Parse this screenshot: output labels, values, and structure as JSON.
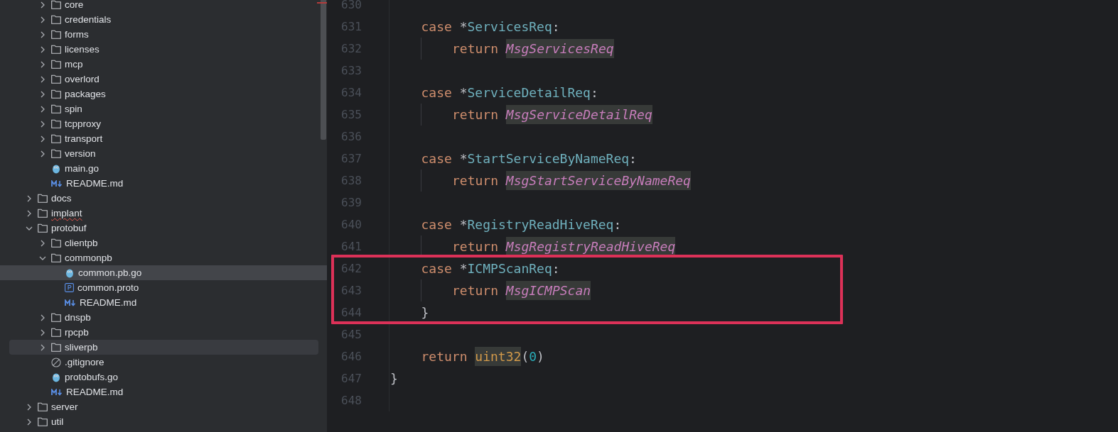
{
  "project_tree": {
    "continued_items": [
      {
        "label": "core",
        "kind": "folder",
        "expanded": false,
        "selected": false,
        "hovered": false,
        "error": false
      },
      {
        "label": "credentials",
        "kind": "folder",
        "expanded": false,
        "selected": false,
        "hovered": false,
        "error": false
      },
      {
        "label": "forms",
        "kind": "folder",
        "expanded": false,
        "selected": false,
        "hovered": false,
        "error": false
      },
      {
        "label": "licenses",
        "kind": "folder",
        "expanded": false,
        "selected": false,
        "hovered": false,
        "error": false
      },
      {
        "label": "mcp",
        "kind": "folder",
        "expanded": false,
        "selected": false,
        "hovered": false,
        "error": false
      },
      {
        "label": "overlord",
        "kind": "folder",
        "expanded": false,
        "selected": false,
        "hovered": false,
        "error": false
      },
      {
        "label": "packages",
        "kind": "folder",
        "expanded": false,
        "selected": false,
        "hovered": false,
        "error": false
      },
      {
        "label": "spin",
        "kind": "folder",
        "expanded": false,
        "selected": false,
        "hovered": false,
        "error": false
      },
      {
        "label": "tcpproxy",
        "kind": "folder",
        "expanded": false,
        "selected": false,
        "hovered": false,
        "error": false
      },
      {
        "label": "transport",
        "kind": "folder",
        "expanded": false,
        "selected": false,
        "hovered": false,
        "error": false
      },
      {
        "label": "version",
        "kind": "folder",
        "expanded": false,
        "selected": false,
        "hovered": false,
        "error": false
      },
      {
        "label": "main.go",
        "kind": "go",
        "selected": false,
        "hovered": false,
        "error": false
      },
      {
        "label": "README.md",
        "kind": "markdown",
        "selected": false,
        "hovered": false,
        "error": false
      }
    ],
    "items": [
      {
        "label": "docs",
        "kind": "folder",
        "expanded": false,
        "selected": false,
        "hovered": false,
        "error": false
      },
      {
        "label": "implant",
        "kind": "folder",
        "expanded": false,
        "selected": false,
        "hovered": false,
        "error": true
      },
      {
        "label": "protobuf",
        "kind": "folder",
        "expanded": true,
        "selected": false,
        "hovered": false,
        "error": false,
        "children": [
          {
            "label": "clientpb",
            "kind": "folder",
            "expanded": false,
            "selected": false,
            "hovered": false,
            "error": false
          },
          {
            "label": "commonpb",
            "kind": "folder",
            "expanded": true,
            "selected": false,
            "hovered": false,
            "error": false,
            "children": [
              {
                "label": "common.pb.go",
                "kind": "go",
                "selected": true,
                "hovered": false,
                "error": false
              },
              {
                "label": "common.proto",
                "kind": "proto",
                "selected": false,
                "hovered": false,
                "error": false
              },
              {
                "label": "README.md",
                "kind": "markdown",
                "selected": false,
                "hovered": false,
                "error": false
              }
            ]
          },
          {
            "label": "dnspb",
            "kind": "folder",
            "expanded": false,
            "selected": false,
            "hovered": false,
            "error": false
          },
          {
            "label": "rpcpb",
            "kind": "folder",
            "expanded": false,
            "selected": false,
            "hovered": false,
            "error": false
          },
          {
            "label": "sliverpb",
            "kind": "folder",
            "expanded": false,
            "selected": false,
            "hovered": true,
            "error": false
          },
          {
            "label": ".gitignore",
            "kind": "ignore",
            "selected": false,
            "hovered": false,
            "error": false
          },
          {
            "label": "protobufs.go",
            "kind": "go",
            "selected": false,
            "hovered": false,
            "error": false
          },
          {
            "label": "README.md",
            "kind": "markdown",
            "selected": false,
            "hovered": false,
            "error": false
          }
        ]
      },
      {
        "label": "server",
        "kind": "folder",
        "expanded": false,
        "selected": false,
        "hovered": false,
        "error": false
      },
      {
        "label": "util",
        "kind": "folder",
        "expanded": false,
        "selected": false,
        "hovered": false,
        "error": false
      }
    ]
  },
  "editor": {
    "lines": [
      {
        "number": "630",
        "kind": "blank"
      },
      {
        "number": "631",
        "kind": "case",
        "tokens": [
          {
            "text": "case",
            "kind": "keyword"
          },
          {
            "text": "*",
            "kind": "punct"
          },
          {
            "text": "ServicesReq",
            "kind": "type"
          },
          {
            "text": ":",
            "kind": "punct"
          }
        ]
      },
      {
        "number": "632",
        "kind": "return",
        "tokens": [
          {
            "text": "return",
            "kind": "keyword"
          },
          {
            "text": "MsgServicesReq",
            "kind": "constant"
          }
        ]
      },
      {
        "number": "633",
        "kind": "blank"
      },
      {
        "number": "634",
        "kind": "case",
        "tokens": [
          {
            "text": "case",
            "kind": "keyword"
          },
          {
            "text": "*",
            "kind": "punct"
          },
          {
            "text": "ServiceDetailReq",
            "kind": "type"
          },
          {
            "text": ":",
            "kind": "punct"
          }
        ]
      },
      {
        "number": "635",
        "kind": "return",
        "tokens": [
          {
            "text": "return",
            "kind": "keyword"
          },
          {
            "text": "MsgServiceDetailReq",
            "kind": "constant"
          }
        ]
      },
      {
        "number": "636",
        "kind": "blank"
      },
      {
        "number": "637",
        "kind": "case",
        "tokens": [
          {
            "text": "case",
            "kind": "keyword"
          },
          {
            "text": "*",
            "kind": "punct"
          },
          {
            "text": "StartServiceByNameReq",
            "kind": "type"
          },
          {
            "text": ":",
            "kind": "punct"
          }
        ]
      },
      {
        "number": "638",
        "kind": "return",
        "tokens": [
          {
            "text": "return",
            "kind": "keyword"
          },
          {
            "text": "MsgStartServiceByNameReq",
            "kind": "constant"
          }
        ]
      },
      {
        "number": "639",
        "kind": "blank"
      },
      {
        "number": "640",
        "kind": "case",
        "tokens": [
          {
            "text": "case",
            "kind": "keyword"
          },
          {
            "text": "*",
            "kind": "punct"
          },
          {
            "text": "RegistryReadHiveReq",
            "kind": "type"
          },
          {
            "text": ":",
            "kind": "punct"
          }
        ]
      },
      {
        "number": "641",
        "kind": "return",
        "tokens": [
          {
            "text": "return",
            "kind": "keyword"
          },
          {
            "text": "MsgRegistryReadHiveReq",
            "kind": "constant"
          }
        ]
      },
      {
        "number": "642",
        "kind": "case",
        "tokens": [
          {
            "text": "case",
            "kind": "keyword"
          },
          {
            "text": "*",
            "kind": "punct"
          },
          {
            "text": "ICMPScanReq",
            "kind": "type"
          },
          {
            "text": ":",
            "kind": "punct"
          }
        ]
      },
      {
        "number": "643",
        "kind": "return",
        "tokens": [
          {
            "text": "return",
            "kind": "keyword"
          },
          {
            "text": "MsgICMPScan",
            "kind": "constant"
          }
        ]
      },
      {
        "number": "644",
        "kind": "statement",
        "tokens": [
          {
            "text": "}",
            "kind": "punct"
          }
        ]
      },
      {
        "number": "645",
        "kind": "blank"
      },
      {
        "number": "646",
        "kind": "statement",
        "tokens": [
          {
            "text": "return",
            "kind": "keyword"
          },
          {
            "text": "uint32",
            "kind": "builtin"
          },
          {
            "text": "(",
            "kind": "punct"
          },
          {
            "text": "0",
            "kind": "number"
          },
          {
            "text": ")",
            "kind": "punct"
          }
        ]
      },
      {
        "number": "647",
        "kind": "top",
        "tokens": [
          {
            "text": "}",
            "kind": "punct"
          }
        ]
      },
      {
        "number": "648",
        "kind": "blank"
      }
    ]
  }
}
